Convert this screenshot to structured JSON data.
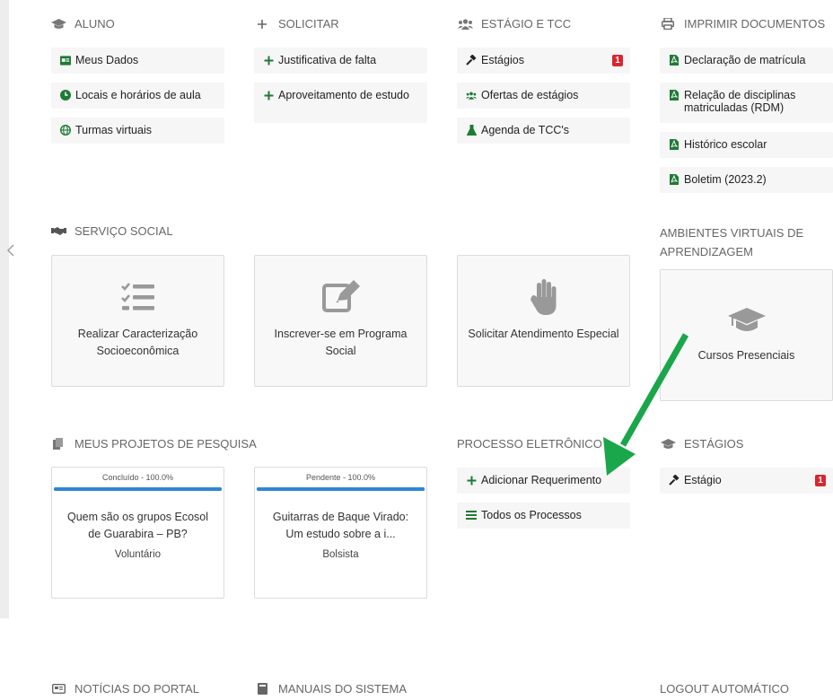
{
  "sidebar": {
    "collapse_icon": "chevron-left-icon"
  },
  "aluno": {
    "title": "ALUNO",
    "icon": "graduation-cap-icon",
    "items": [
      {
        "label": "Meus Dados",
        "icon": "id-card-icon"
      },
      {
        "label": "Locais e horários de aula",
        "icon": "clock-icon"
      },
      {
        "label": "Turmas virtuais",
        "icon": "globe-icon"
      }
    ]
  },
  "solicitar": {
    "title": "SOLICITAR",
    "icon": "plus-icon",
    "items": [
      {
        "label": "Justificativa de falta",
        "icon": "plus-icon"
      },
      {
        "label": "Aproveitamento de estudo",
        "icon": "plus-icon"
      }
    ]
  },
  "estagio_tcc": {
    "title": "ESTÁGIO E TCC",
    "icon": "users-icon",
    "items": [
      {
        "label": "Estágios",
        "icon": "gavel-icon",
        "badge": "1"
      },
      {
        "label": "Ofertas de estágios",
        "icon": "users-icon"
      },
      {
        "label": "Agenda de TCC's",
        "icon": "flask-icon"
      }
    ]
  },
  "imprimir": {
    "title": "IMPRIMIR DOCUMENTOS",
    "icon": "print-icon",
    "items": [
      {
        "label": "Declaração de matrícula",
        "icon": "pdf-icon"
      },
      {
        "label": "Relação de disciplinas matriculadas (RDM)",
        "icon": "pdf-icon"
      },
      {
        "label": "Histórico escolar",
        "icon": "pdf-icon"
      },
      {
        "label": "Boletim (2023.2)",
        "icon": "pdf-icon"
      }
    ]
  },
  "servico_social": {
    "title": "SERVIÇO SOCIAL",
    "icon": "handshake-icon",
    "cards": [
      {
        "label": "Realizar Caracterização Socioeconômica",
        "icon": "checklist-icon"
      },
      {
        "label": "Inscrever-se em Programa Social",
        "icon": "edit-icon"
      },
      {
        "label": "Solicitar Atendimento Especial",
        "icon": "hand-icon"
      }
    ]
  },
  "ava": {
    "title": "AMBIENTES VIRTUAIS DE APRENDIZAGEM",
    "cards": [
      {
        "label": "Cursos Presenciais",
        "icon": "graduation-cap-icon"
      }
    ]
  },
  "pesquisa": {
    "title": "MEUS PROJETOS DE PESQUISA",
    "icon": "files-icon",
    "projects": [
      {
        "status": "Concluído - 100.0%",
        "progress": 1.0,
        "title": "Quem são os grupos Ecosol de Guarabira – PB?",
        "role": "Voluntário"
      },
      {
        "status": "Pendente - 100.0%",
        "progress": 1.0,
        "title": "Guitarras de Baque Virado: Um estudo sobre a i...",
        "role": "Bolsista"
      }
    ]
  },
  "processo": {
    "title": "PROCESSO ELETRÔNICO",
    "items": [
      {
        "label": "Adicionar Requerimento",
        "icon": "plus-icon"
      },
      {
        "label": "Todos os Processos",
        "icon": "list-icon"
      }
    ]
  },
  "estagios2": {
    "title": "ESTÁGIOS",
    "icon": "graduation-cap-icon",
    "items": [
      {
        "label": "Estágio",
        "icon": "gavel-icon",
        "badge": "1"
      }
    ]
  },
  "noticias": {
    "title": "NOTÍCIAS DO PORTAL",
    "icon": "newspaper-icon"
  },
  "manuais": {
    "title": "MANUAIS DO SISTEMA",
    "icon": "book-icon"
  },
  "logout": {
    "title": "LOGOUT AUTOMÁTICO"
  },
  "annotation": {
    "arrow_color": "#1aa64a"
  }
}
